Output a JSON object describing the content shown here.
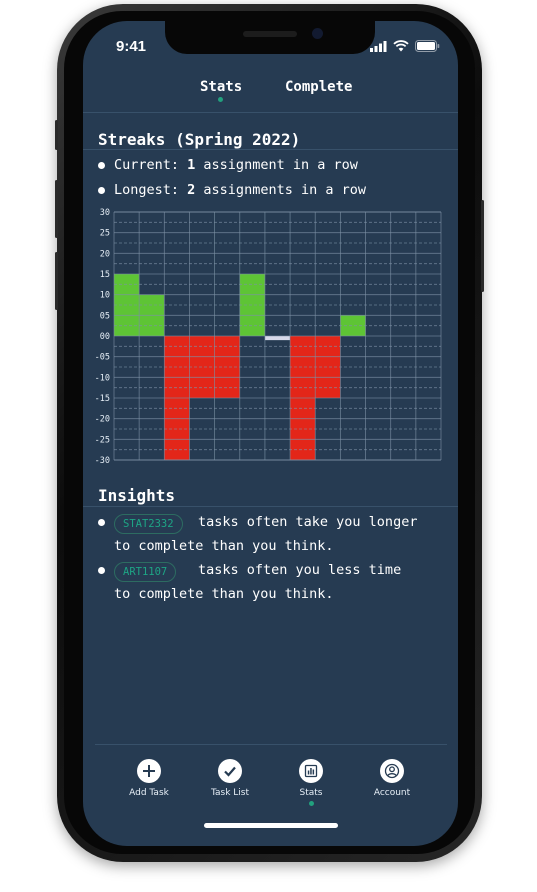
{
  "status_bar": {
    "time": "9:41"
  },
  "tabs": [
    {
      "label": "Stats",
      "active": true
    },
    {
      "label": "Complete",
      "active": false
    }
  ],
  "streaks": {
    "title": "Streaks (Spring 2022)",
    "current": {
      "prefix": "Current: ",
      "value": "1",
      "suffix": " assignment in a row"
    },
    "longest": {
      "prefix": "Longest: ",
      "value": "2",
      "suffix": " assignments in a row"
    }
  },
  "chart_data": {
    "type": "bar",
    "y_tick_labels": [
      "30",
      "25",
      "20",
      "15",
      "10",
      "05",
      "00",
      "-05",
      "-10",
      "-15",
      "-20",
      "-25",
      "-30"
    ],
    "ylim": [
      -30,
      30
    ],
    "grid": true,
    "values": [
      15,
      10,
      -30,
      -15,
      -15,
      15,
      -1,
      -30,
      -15,
      5,
      0,
      0,
      0
    ],
    "colors": {
      "positive": "#5ec435",
      "negative": "#e32619",
      "neutral": "#d7d9ea"
    }
  },
  "insights": {
    "title": "Insights",
    "items": [
      {
        "course": "STAT2332",
        "line1": "tasks often take you longer",
        "line2": "to complete than you think."
      },
      {
        "course": "ART1107",
        "line1": "tasks often you less time",
        "line2": "to complete than you think."
      }
    ]
  },
  "bottom_nav": [
    {
      "label": "Add Task",
      "icon": "plus-circle-icon",
      "active": false
    },
    {
      "label": "Task List",
      "icon": "check-circle-icon",
      "active": false
    },
    {
      "label": "Stats",
      "icon": "bar-chart-icon",
      "active": true
    },
    {
      "label": "Account",
      "icon": "user-circle-icon",
      "active": false
    }
  ],
  "theme": {
    "accent": "#22a17e",
    "background": "#263b52"
  }
}
